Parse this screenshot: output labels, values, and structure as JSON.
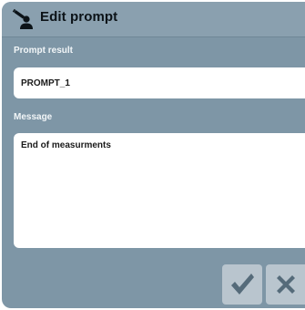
{
  "dialog": {
    "title": "Edit prompt",
    "title_icon": "user-pencil-icon"
  },
  "fields": {
    "prompt_result_label": "Prompt result",
    "prompt_result_value": "PROMPT_1",
    "message_label": "Message",
    "message_value": "End of measurments"
  },
  "actions": {
    "confirm_icon": "checkmark-icon",
    "cancel_icon": "close-icon"
  },
  "colors": {
    "dialog_background": "#7e96a6",
    "title_bar": "#8aa0af",
    "button_background": "#b9c5ce",
    "icon_color": "#556b7a"
  }
}
